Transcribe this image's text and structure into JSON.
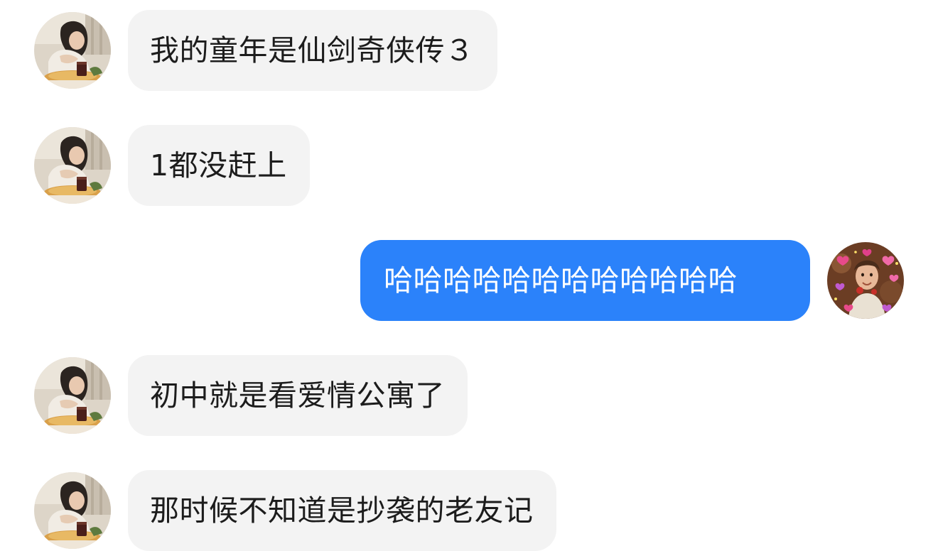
{
  "chat": {
    "messages": [
      {
        "sender": "other",
        "avatar": "woman-photo-avatar",
        "text": "我的童年是仙剑奇侠传３"
      },
      {
        "sender": "other",
        "avatar": "woman-photo-avatar",
        "text": "1都没赶上"
      },
      {
        "sender": "self",
        "avatar": "child-hearts-avatar",
        "text": "哈哈哈哈哈哈哈哈哈哈哈哈"
      },
      {
        "sender": "other",
        "avatar": "woman-photo-avatar",
        "text": "初中就是看爱情公寓了"
      },
      {
        "sender": "other",
        "avatar": "woman-photo-avatar",
        "text": "那时候不知道是抄袭的老友记"
      }
    ]
  },
  "colors": {
    "incoming_bubble": "#f3f3f3",
    "outgoing_bubble": "#2b82fa",
    "incoming_text": "#1c1c1c",
    "outgoing_text": "#ffffff"
  }
}
